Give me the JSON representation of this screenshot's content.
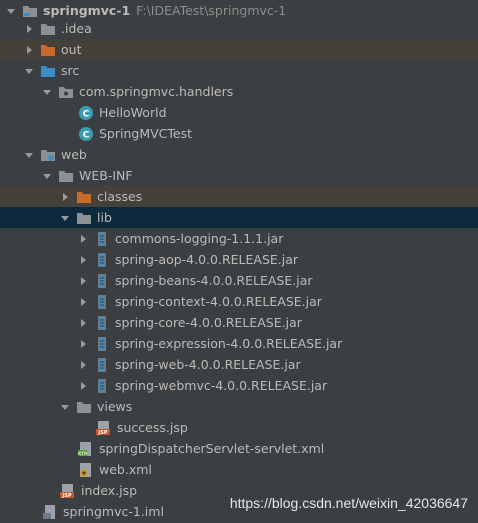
{
  "colors": {
    "background": "#3c3f41",
    "selected_row": "#0d293e",
    "excluded_row": "#45403a",
    "folder_gray": "#8c9196",
    "folder_blue": "#3b8fc6",
    "folder_orange": "#c76a2a",
    "class_teal": "#3c9db2",
    "text": "#bbbbbb"
  },
  "project": {
    "name": "springmvc-1",
    "path": "F:\\IDEATest\\springmvc-1"
  },
  "tree": {
    "idea": ".idea",
    "out": "out",
    "src": "src",
    "package": "com.springmvc.handlers",
    "class_hello": "HelloWorld",
    "class_test": "SpringMVCTest",
    "web": "web",
    "webinf": "WEB-INF",
    "classes": "classes",
    "lib": "lib",
    "jars": [
      "commons-logging-1.1.1.jar",
      "spring-aop-4.0.0.RELEASE.jar",
      "spring-beans-4.0.0.RELEASE.jar",
      "spring-context-4.0.0.RELEASE.jar",
      "spring-core-4.0.0.RELEASE.jar",
      "spring-expression-4.0.0.RELEASE.jar",
      "spring-web-4.0.0.RELEASE.jar",
      "spring-webmvc-4.0.0.RELEASE.jar"
    ],
    "views": "views",
    "success": "success.jsp",
    "servlet_xml": "springDispatcherServlet-servlet.xml",
    "web_xml": "web.xml",
    "index": "index.jsp",
    "iml": "springmvc-1.iml"
  },
  "watermark": "https://blog.csdn.net/weixin_42036647"
}
